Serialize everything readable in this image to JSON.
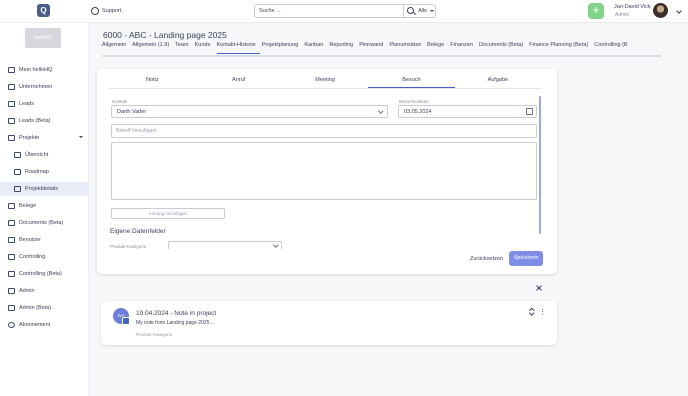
{
  "header": {
    "logo_text": "Q",
    "support_label": "Support",
    "search_placeholder": "Suche ...",
    "search_scope": "Alle",
    "add_label": "+",
    "user_name": "Jan-David Vick",
    "user_role": "Admin"
  },
  "sidebar": {
    "org_logo_text": "helloHQ",
    "items": [
      {
        "label": "Mein helloHQ"
      },
      {
        "label": "Unternehmen"
      },
      {
        "label": "Leads"
      },
      {
        "label": "Leads (Beta)"
      },
      {
        "label": "Projekte"
      },
      {
        "label": "Übersicht"
      },
      {
        "label": "Roadmap"
      },
      {
        "label": "Projektdetails"
      },
      {
        "label": "Belege"
      },
      {
        "label": "Documents (Beta)"
      },
      {
        "label": "Benutzer"
      },
      {
        "label": "Controlling"
      },
      {
        "label": "Controlling (Beta)"
      },
      {
        "label": "Admin"
      },
      {
        "label": "Admin (Beta)"
      },
      {
        "label": "Abonnement"
      }
    ]
  },
  "page": {
    "title": "6000 - ABC - Landing page 2025",
    "tabs": [
      "Allgemein",
      "Allgemein (1.9)",
      "Team",
      "Kunde",
      "Kontakt-Historie",
      "Projektplanung",
      "Kanban",
      "Reporting",
      "Pinnwand",
      "Planumsätze",
      "Belege",
      "Finanzen",
      "Documents (Beta)",
      "Finance Planning (Beta)",
      "Controlling (B"
    ],
    "active_tab": "Kontakt-Historie"
  },
  "form": {
    "subtabs": [
      "Notiz",
      "Anruf",
      "Meeting",
      "Besuch",
      "Aufgabe"
    ],
    "active_subtab": "Besuch",
    "contact_label": "Kontakt",
    "contact_value": "Darth Vader",
    "date_label": "Besuchsdatum",
    "date_value": "03.05.2024",
    "subject_placeholder": "Betreff hinzufügen",
    "attachment_label": "Anhang hinzufügen",
    "custom_fields_title": "Eigene Datenfelder",
    "category_label": "Produkt-Kategorie",
    "reset_label": "Zurücksetzen",
    "save_label": "Speichern"
  },
  "note": {
    "avatar_initials": "JvA",
    "title": "19.04.2024 - Note in project",
    "text": "My note from Landing page 2025 ...",
    "category": "Produkt-Kategorie",
    "menu_icon": "⋮"
  }
}
